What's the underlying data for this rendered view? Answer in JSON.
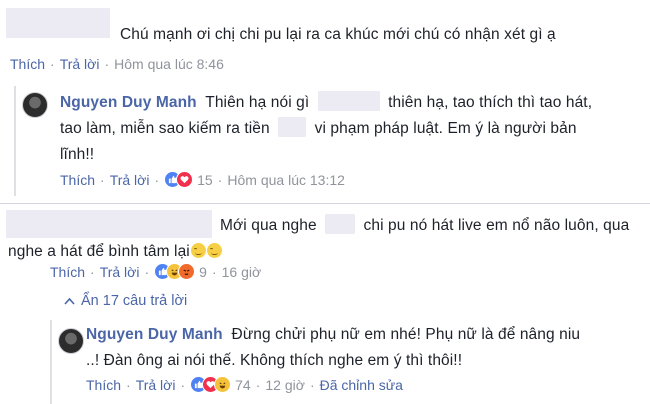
{
  "comments": [
    {
      "text": "Chú mạnh ơi chị chi pu lại ra ca khúc mới chú có nhận xét gì ạ",
      "like": "Thích",
      "reply": "Trả lời",
      "time": "Hôm qua lúc 8:46"
    },
    {
      "author": "Nguyen Duy Manh",
      "line1a": "Thiên hạ nói gì",
      "line1b": "thiên hạ, tao thích thì tao hát,",
      "line2a": "tao làm, miễn sao kiếm ra tiền",
      "line2b": "vi phạm pháp luật. Em ý là người bản",
      "line3": "lĩnh!!",
      "like": "Thích",
      "reply": "Trả lời",
      "reaction_count": "15",
      "time": "Hôm qua lúc 13:12",
      "reactions": [
        "like-icon",
        "love-icon"
      ]
    },
    {
      "line1a": "Mới qua nghe",
      "line1b": "chi pu nó hát live em nổ não luôn, qua",
      "line2": "nghe a hát để bình tâm lại",
      "like": "Thích",
      "reply": "Trả lời",
      "reaction_count": "9",
      "time": "16 giờ",
      "reactions": [
        "like-icon",
        "haha-icon",
        "angry-icon"
      ]
    },
    {
      "author": "Nguyen Duy Manh",
      "line1": "Đừng chửi phụ nữ em nhé! Phụ nữ là để nâng niu",
      "line2": "..! Đàn ông ai nói thế. Không thích nghe em ý thì thôi!!",
      "like": "Thích",
      "reply": "Trả lời",
      "reaction_count": "74",
      "time": "12 giờ",
      "edited": "Đã chỉnh sửa",
      "reactions": [
        "like-icon",
        "love-icon",
        "haha-icon"
      ]
    }
  ],
  "hide_replies": "Ẩn 17 câu trả lời",
  "middot": "·",
  "colors": {
    "link": "#4b66a7",
    "meta": "#90949c",
    "like": "#4f82f2",
    "love": "#f0304d",
    "haha": "#f5c33b"
  }
}
